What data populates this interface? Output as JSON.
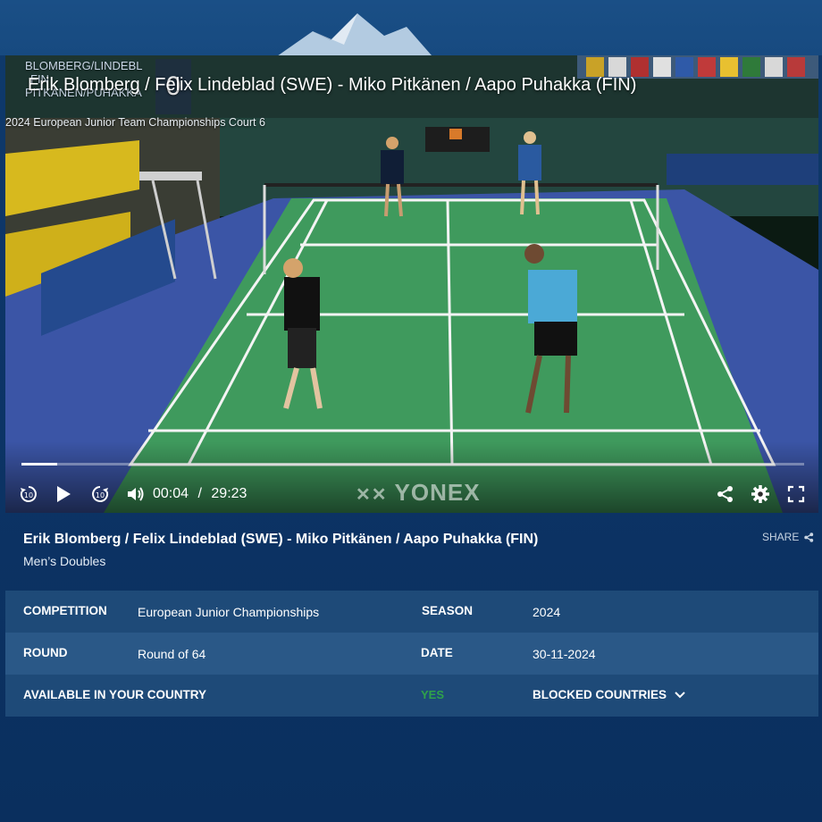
{
  "video": {
    "overlay_title": "Erik Blomberg / Felix Lindeblad (SWE) - Miko Pitkänen / Aapo Puhakka (FIN)",
    "overlay_subtitle": "2024 European Junior Team Championships Court 6",
    "scorebug": {
      "team1": "BLOMBERG/LINDEBL",
      "team2_code": "FIN",
      "team2": "PITKÄNEN/PUHAKKA",
      "score_digit": "0"
    },
    "progress_fraction": 0.046,
    "current_time": "00:04",
    "time_separator": "/",
    "duration": "29:23",
    "watermark": "YONEX",
    "controls": {
      "rewind_icon": "rewind-10-icon",
      "play_icon": "play-icon",
      "forward_icon": "forward-10-icon",
      "volume_icon": "volume-icon",
      "share_icon": "share-icon",
      "settings_icon": "gear-icon",
      "fullscreen_icon": "fullscreen-icon"
    }
  },
  "match": {
    "title": "Erik Blomberg / Felix Lindeblad (SWE) - Miko Pitkänen / Aapo Puhakka (FIN)",
    "category": "Men’s Doubles",
    "share_label": "SHARE"
  },
  "details": {
    "competition_label": "COMPETITION",
    "competition_value": "European Junior Championships",
    "season_label": "SEASON",
    "season_value": "2024",
    "round_label": "ROUND",
    "round_value": "Round of 64",
    "date_label": "DATE",
    "date_value": "30-11-2024",
    "available_label": "AVAILABLE IN YOUR COUNTRY",
    "available_value": "YES",
    "blocked_label": "BLOCKED COUNTRIES"
  },
  "colors": {
    "background": "#0d3567",
    "row_dark": "#1e4a78",
    "row_light": "#2a5887",
    "court_green": "#3f9a5d",
    "court_blue": "#3b55a6",
    "yes_green": "#2fa24a"
  }
}
